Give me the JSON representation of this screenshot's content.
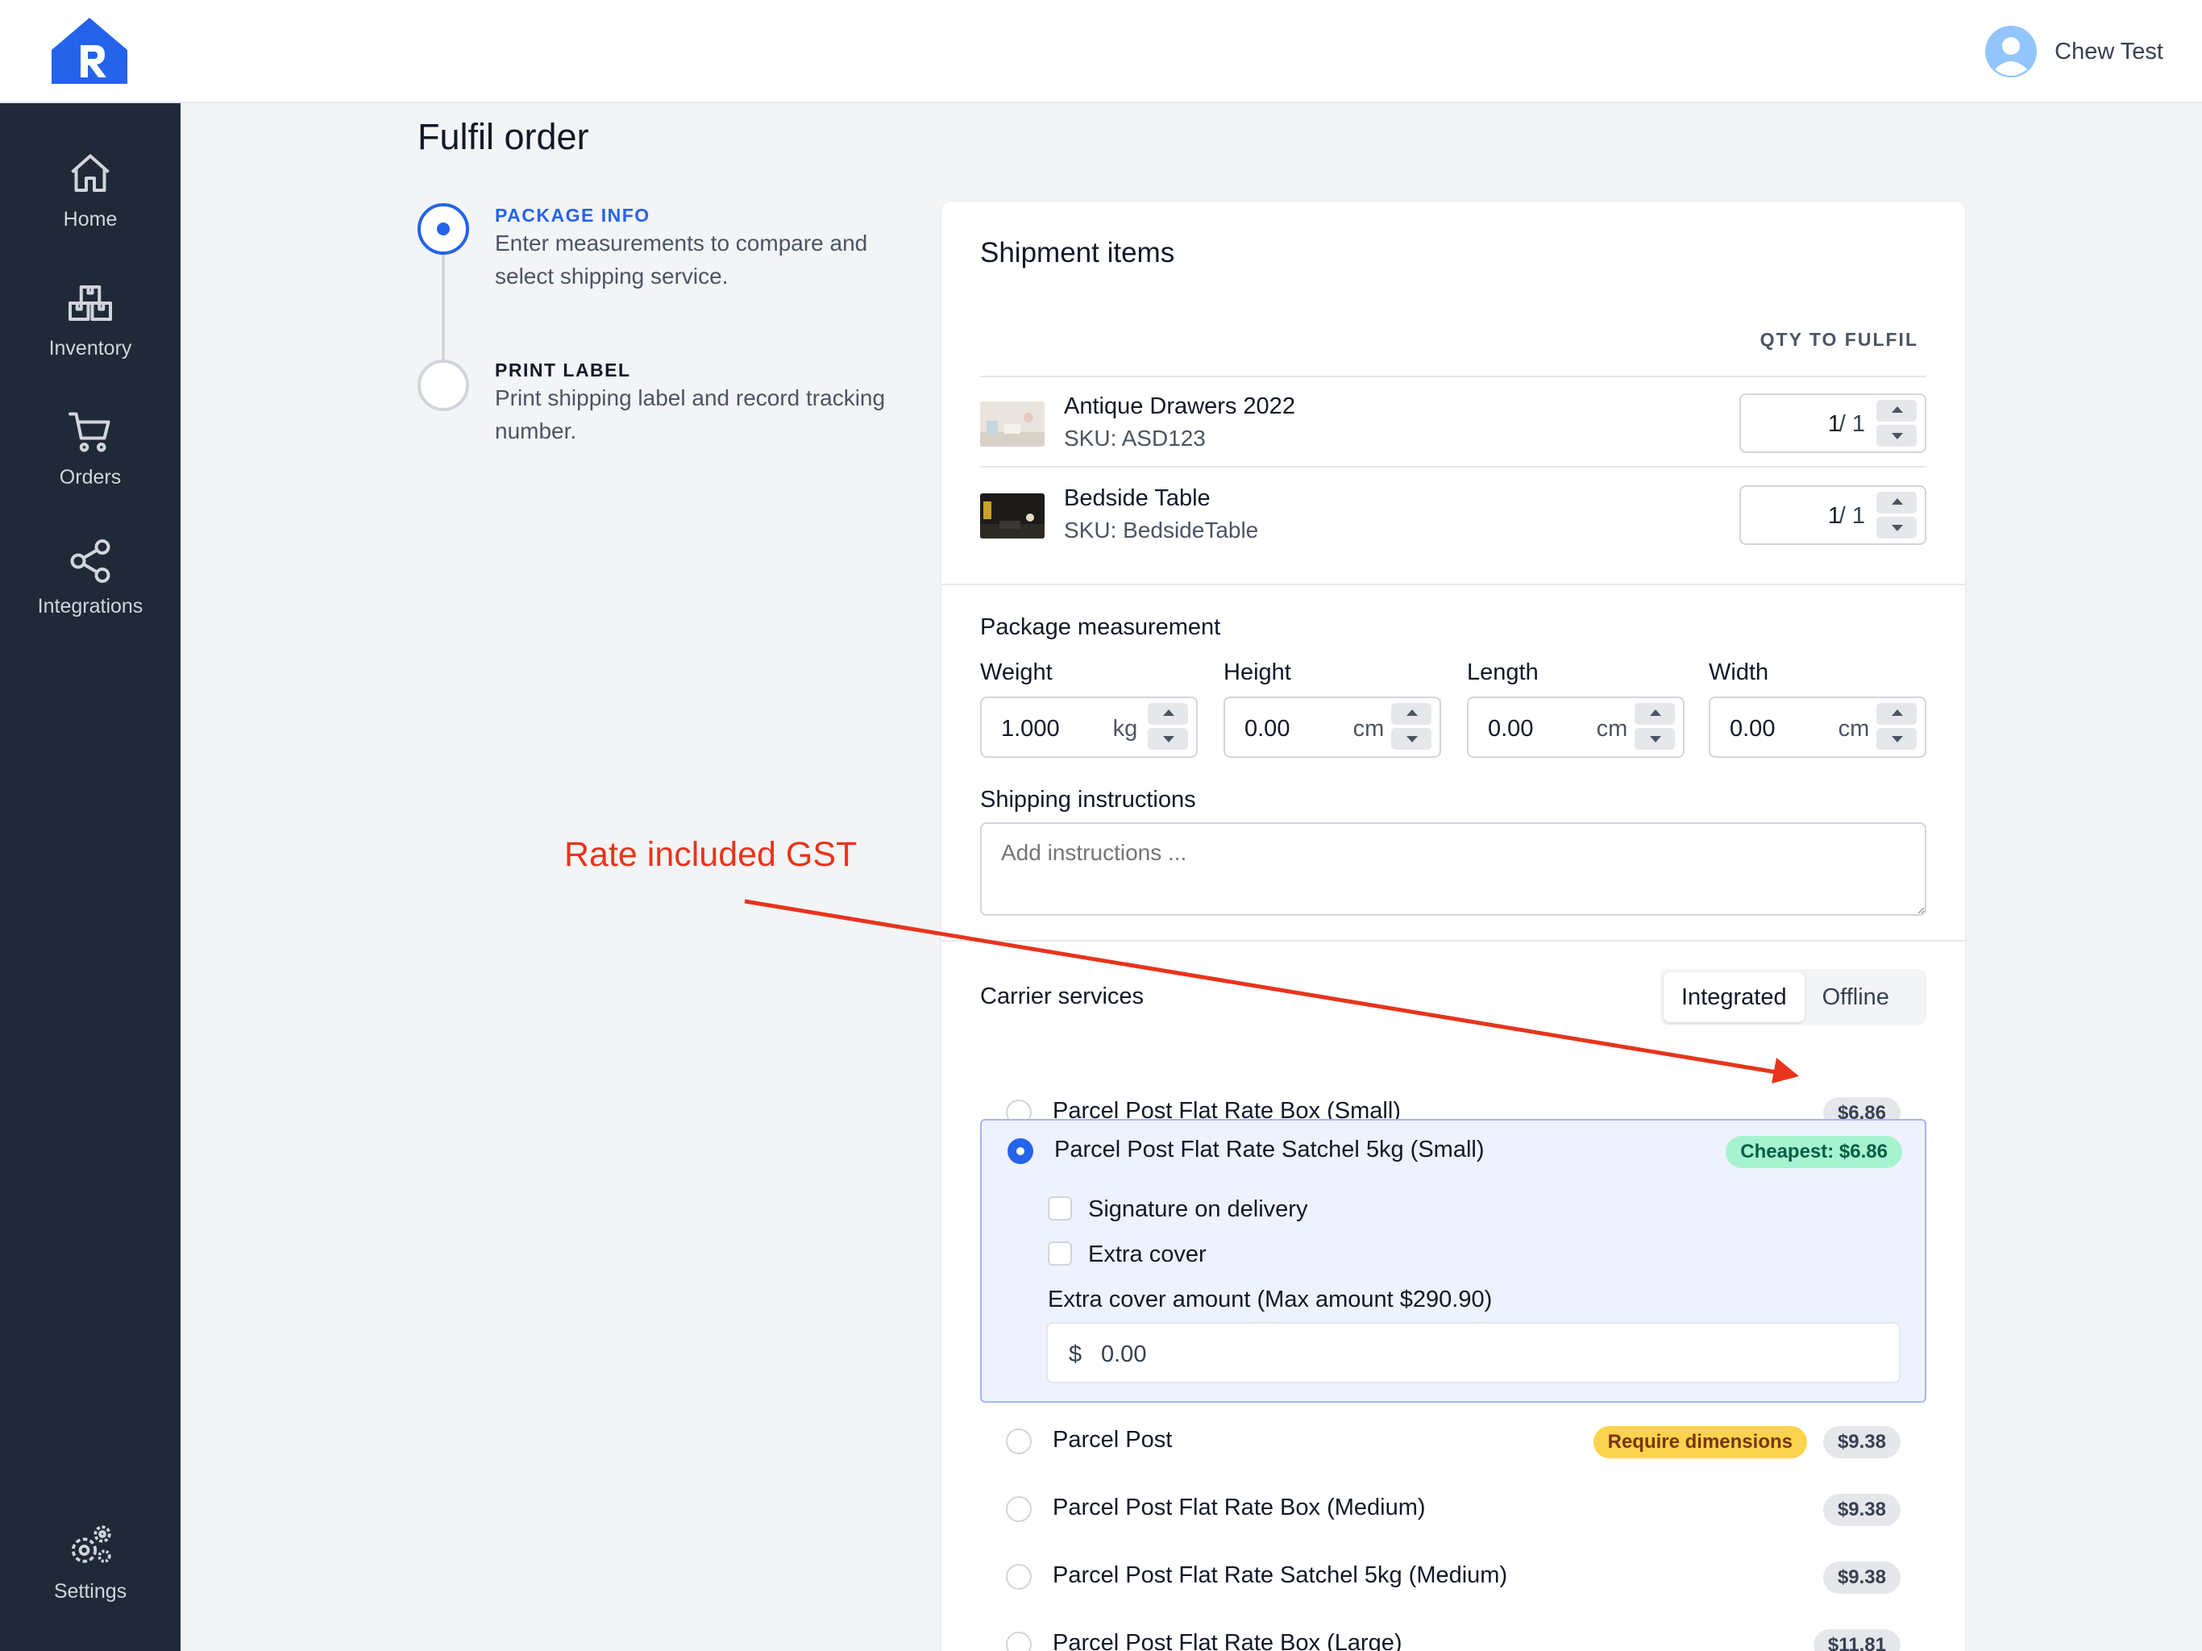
{
  "app": {
    "user_name": "Chew Test"
  },
  "sidebar": {
    "items": [
      {
        "label": "Home",
        "icon": "home-icon"
      },
      {
        "label": "Inventory",
        "icon": "inventory-icon"
      },
      {
        "label": "Orders",
        "icon": "cart-icon"
      },
      {
        "label": "Integrations",
        "icon": "share-icon"
      }
    ],
    "settings_label": "Settings"
  },
  "page": {
    "title": "Fulfil order"
  },
  "steps": [
    {
      "title": "PACKAGE INFO",
      "desc": "Enter measurements to compare and select shipping service.",
      "state": "current"
    },
    {
      "title": "PRINT LABEL",
      "desc": "Print shipping label and record tracking number.",
      "state": "upcoming"
    }
  ],
  "annotation": {
    "text": "Rate included GST",
    "color": "#e8341c"
  },
  "shipment": {
    "title": "Shipment items",
    "qty_header": "QTY TO FULFIL",
    "items": [
      {
        "name": "Antique Drawers 2022",
        "sku": "SKU: ASD123",
        "qty": "1",
        "max": "/ 1"
      },
      {
        "name": "Bedside Table",
        "sku": "SKU: BedsideTable",
        "qty": "1",
        "max": "/ 1"
      }
    ]
  },
  "package": {
    "section_label": "Package measurement",
    "fields": [
      {
        "label": "Weight",
        "value": "1.000",
        "unit": "kg"
      },
      {
        "label": "Height",
        "value": "0.00",
        "unit": "cm"
      },
      {
        "label": "Length",
        "value": "0.00",
        "unit": "cm"
      },
      {
        "label": "Width",
        "value": "0.00",
        "unit": "cm"
      }
    ],
    "instructions_label": "Shipping instructions",
    "instructions_placeholder": "Add instructions ..."
  },
  "carrier": {
    "section_label": "Carrier services",
    "tabs": {
      "integrated": "Integrated",
      "offline": "Offline"
    },
    "options": [
      {
        "label": "Parcel Post Flat Rate Box (Small)",
        "price": "$6.86"
      },
      {
        "label": "Parcel Post Flat Rate Satchel 5kg (Small)",
        "price": "Cheapest: $6.86",
        "selected": true
      },
      {
        "label": "Parcel Post",
        "price": "$9.38",
        "warning": "Require dimensions"
      },
      {
        "label": "Parcel Post Flat Rate Box (Medium)",
        "price": "$9.38"
      },
      {
        "label": "Parcel Post Flat Rate Satchel 5kg (Medium)",
        "price": "$9.38"
      },
      {
        "label": "Parcel Post Flat Rate Box (Large)",
        "price": "$11.81"
      }
    ],
    "extras": {
      "signature_label": "Signature on delivery",
      "cover_label": "Extra cover",
      "cover_amount_label": "Extra cover amount (Max amount $290.90)",
      "currency_symbol": "$",
      "cover_amount_value": "0.00"
    }
  },
  "colors": {
    "accent": "#2563eb",
    "sidebar_bg": "#1f2937",
    "cheapest_badge": "#a7f3d0",
    "warning_badge": "#fcd34d"
  }
}
